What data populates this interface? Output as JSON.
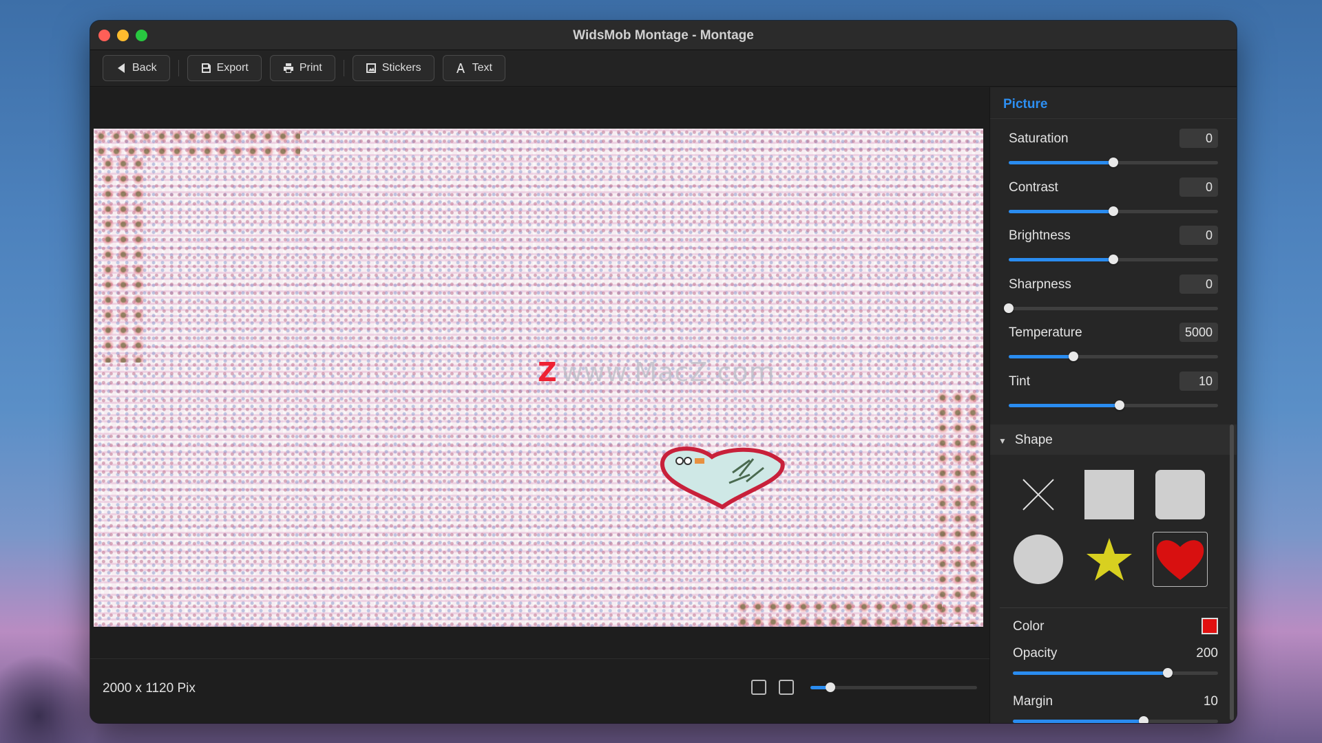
{
  "window": {
    "title": "WidsMob Montage - Montage"
  },
  "toolbar": {
    "back_label": "Back",
    "export_label": "Export",
    "print_label": "Print",
    "stickers_label": "Stickers",
    "text_label": "Text"
  },
  "canvas": {
    "watermark_text": "www.MacZ.com",
    "watermark_logo": "Z"
  },
  "status": {
    "dimensions": "2000 x 1120 Pix",
    "zoom_fraction": 0.12
  },
  "panel": {
    "title": "Picture",
    "adjustments": [
      {
        "label": "Saturation",
        "value": "0",
        "fraction": 0.5
      },
      {
        "label": "Contrast",
        "value": "0",
        "fraction": 0.5
      },
      {
        "label": "Brightness",
        "value": "0",
        "fraction": 0.5
      },
      {
        "label": "Sharpness",
        "value": "0",
        "fraction": 0.0
      },
      {
        "label": "Temperature",
        "value": "5000",
        "fraction": 0.31
      },
      {
        "label": "Tint",
        "value": "10",
        "fraction": 0.53
      }
    ],
    "shape_section": {
      "label": "Shape",
      "shapes": [
        "none-icon",
        "square-icon",
        "rounded-square-icon",
        "circle-icon",
        "star-icon",
        "heart-icon"
      ],
      "selected": "heart-icon"
    },
    "color_label": "Color",
    "color_value": "#e01010",
    "opacity_label": "Opacity",
    "opacity_value": "200",
    "opacity_fraction": 0.78,
    "margin_label": "Margin",
    "margin_value": "10",
    "margin_fraction": 0.66
  },
  "colors": {
    "accent": "#2a8cf0",
    "heading": "#2d8ff2",
    "star": "#d8d020",
    "heart": "#d81010"
  }
}
